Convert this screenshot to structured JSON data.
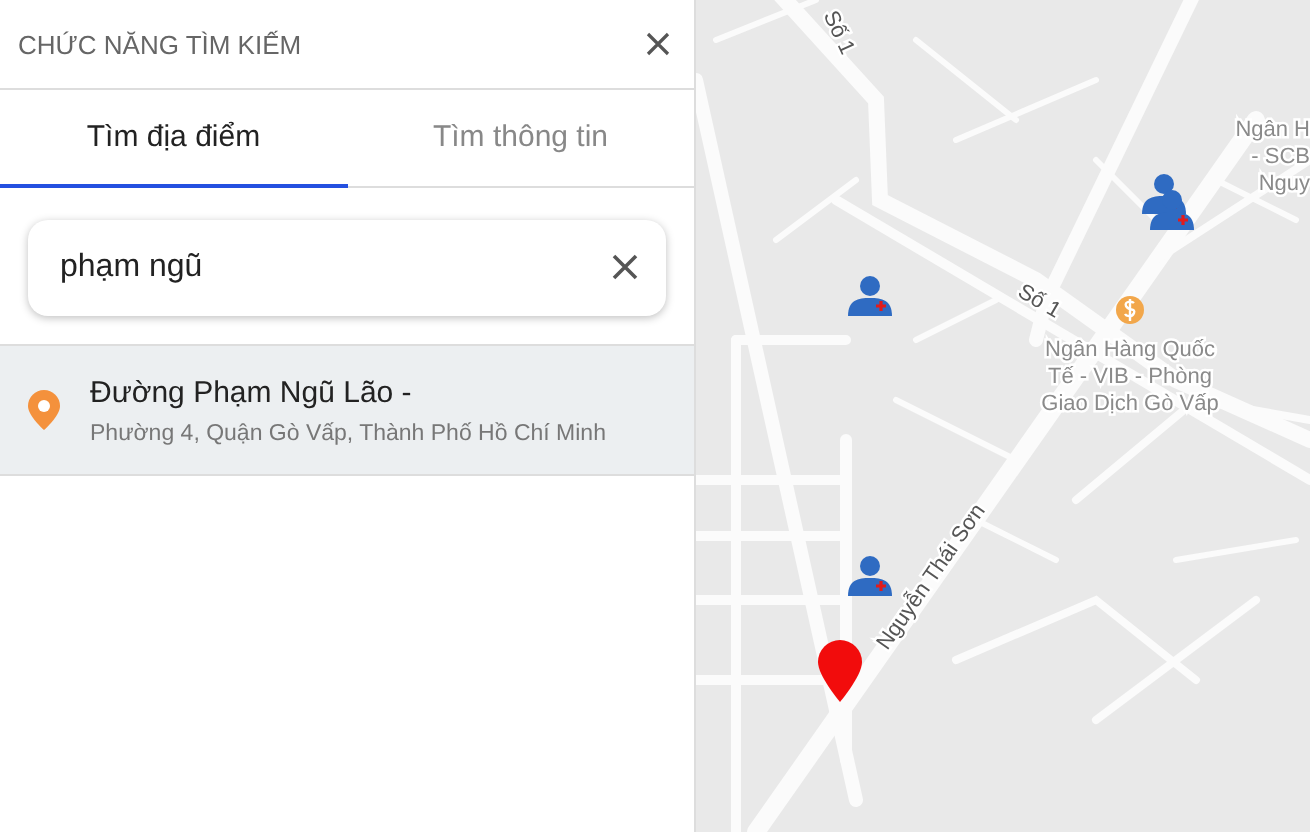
{
  "panel": {
    "title": "CHỨC NĂNG TÌM KIẾM"
  },
  "tabs": [
    {
      "label": "Tìm địa điểm",
      "selected": true
    },
    {
      "label": "Tìm thông tin",
      "selected": false
    }
  ],
  "search": {
    "value": "phạm ngũ"
  },
  "results": [
    {
      "title": "Đường Phạm Ngũ Lão -",
      "address": "Phường 4, Quận Gò Vấp, Thành Phố Hồ Chí Minh"
    }
  ],
  "map": {
    "labels": [
      {
        "kind": "road",
        "lines": [
          "Số 1"
        ]
      },
      {
        "kind": "road",
        "lines": [
          "Số 1"
        ]
      },
      {
        "kind": "poi",
        "lines": [
          "Ngân Hàng Quốc",
          "Tế - VIB - Phòng",
          "Giao Dịch Gò Vấp"
        ]
      },
      {
        "kind": "poi-edge",
        "lines": [
          "Ngân H",
          "- SCB",
          "Nguy"
        ]
      },
      {
        "kind": "road",
        "lines": [
          "Nguyễn Thái Sơn"
        ]
      }
    ]
  }
}
